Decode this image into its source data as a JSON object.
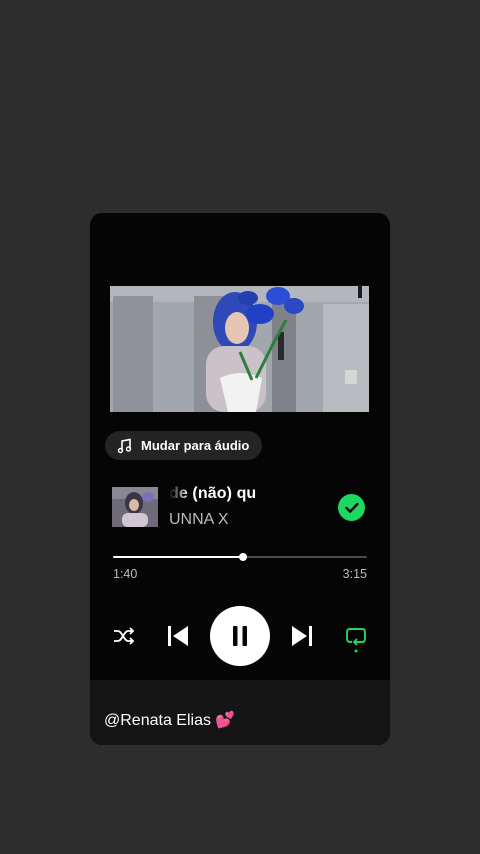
{
  "audio_chip": {
    "label": "Mudar para áudio",
    "icon": "music-note-icon"
  },
  "track": {
    "title_visible": "de            (não) qu",
    "artist": "UNNA X",
    "saved": true
  },
  "playback": {
    "elapsed": "1:40",
    "duration": "3:15",
    "progress_fraction": 0.513,
    "state": "playing"
  },
  "controls": {
    "shuffle_icon": "shuffle-icon",
    "previous_icon": "skip-previous-icon",
    "pause_icon": "pause-icon",
    "next_icon": "skip-next-icon",
    "repeat_icon": "repeat-icon"
  },
  "colors": {
    "accent": "#1ed760",
    "card": "#050505",
    "background": "#2e2d2d"
  },
  "caption": {
    "text": "@Renata Elias 💕"
  }
}
